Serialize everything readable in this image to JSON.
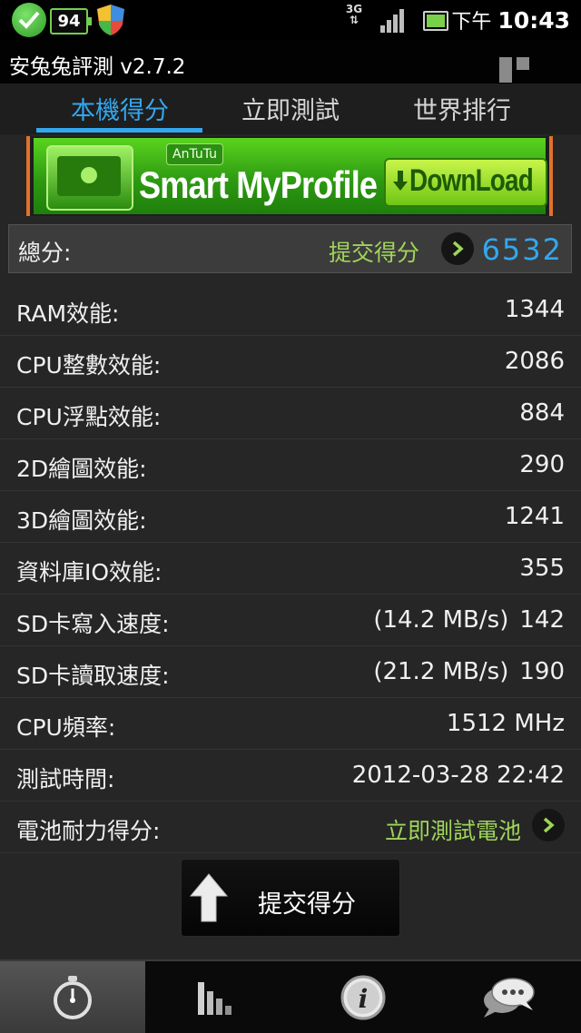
{
  "status_bar": {
    "battery_level": "94",
    "network": "3G",
    "time_prefix": "下午",
    "time": "10:43"
  },
  "app": {
    "title": "安兔兔評測 v2.7.2"
  },
  "tabs": [
    {
      "label": "本機得分",
      "active": true
    },
    {
      "label": "立即測試",
      "active": false
    },
    {
      "label": "世界排行",
      "active": false
    }
  ],
  "banner": {
    "brand": "AnTuTu",
    "text": "Smart MyProfile",
    "button": "DownLoad"
  },
  "total": {
    "label": "總分:",
    "submit_link": "提交得分",
    "score": "6532"
  },
  "scores": [
    {
      "label": "RAM效能:",
      "value": "1344"
    },
    {
      "label": "CPU整數效能:",
      "value": "2086"
    },
    {
      "label": "CPU浮點效能:",
      "value": "884"
    },
    {
      "label": "2D繪圖效能:",
      "value": "290"
    },
    {
      "label": "3D繪圖效能:",
      "value": "1241"
    },
    {
      "label": "資料庫IO效能:",
      "value": "355"
    },
    {
      "label": "SD卡寫入速度:",
      "speed": "(14.2 MB/s)",
      "value": "142"
    },
    {
      "label": "SD卡讀取速度:",
      "speed": "(21.2 MB/s)",
      "value": "190"
    },
    {
      "label": "CPU頻率:",
      "value": "1512 MHz"
    },
    {
      "label": "測試時間:",
      "value": "2012-03-28 22:42"
    }
  ],
  "battery_row": {
    "label": "電池耐力得分:",
    "link": "立即測試電池"
  },
  "submit_button": {
    "label": "提交得分"
  },
  "bottom_nav": [
    {
      "icon": "stopwatch-icon",
      "active": true
    },
    {
      "icon": "bar-chart-icon",
      "active": false
    },
    {
      "icon": "info-icon",
      "active": false
    },
    {
      "icon": "chat-bubbles-icon",
      "active": false
    }
  ]
}
